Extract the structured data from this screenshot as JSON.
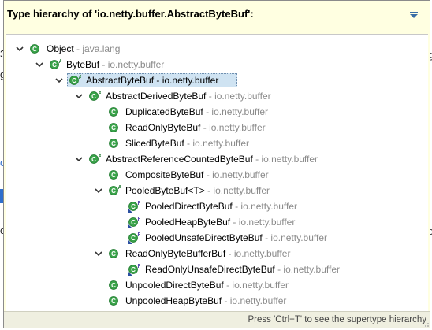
{
  "popup": {
    "title": "Type hierarchy of 'io.netty.buffer.AbstractByteBuf':",
    "footer_hint": "Press 'Ctrl+T' to see the supertype hierarchy"
  },
  "background_fragments": [
    "3",
    "g",
    "o",
    "c"
  ],
  "colors": {
    "popup_bg": "#ffffe1",
    "selection": "#cfe3f2",
    "class_icon": "#3aa34a",
    "abstract_marker": "#2a7d3a",
    "final_marker": "#5a4ab0",
    "package_text": "#8a8a8a"
  },
  "tree": [
    {
      "name": "Object",
      "package": "java.lang",
      "depth": 0,
      "expanded": true,
      "modifier": "",
      "abstract": false
    },
    {
      "name": "ByteBuf",
      "package": "io.netty.buffer",
      "depth": 1,
      "expanded": true,
      "modifier": "A",
      "abstract": true
    },
    {
      "name": "AbstractByteBuf",
      "package": "io.netty.buffer",
      "depth": 2,
      "expanded": true,
      "modifier": "A",
      "abstract": true,
      "selected": true
    },
    {
      "name": "AbstractDerivedByteBuf",
      "package": "io.netty.buffer",
      "depth": 3,
      "expanded": true,
      "modifier": "A",
      "abstract": true
    },
    {
      "name": "DuplicatedByteBuf",
      "package": "io.netty.buffer",
      "depth": 4,
      "expanded": null,
      "modifier": "",
      "abstract": false
    },
    {
      "name": "ReadOnlyByteBuf",
      "package": "io.netty.buffer",
      "depth": 4,
      "expanded": null,
      "modifier": "",
      "abstract": false
    },
    {
      "name": "SlicedByteBuf",
      "package": "io.netty.buffer",
      "depth": 4,
      "expanded": null,
      "modifier": "",
      "abstract": false
    },
    {
      "name": "AbstractReferenceCountedByteBuf",
      "package": "io.netty.buffer",
      "depth": 3,
      "expanded": true,
      "modifier": "A",
      "abstract": true
    },
    {
      "name": "CompositeByteBuf",
      "package": "io.netty.buffer",
      "depth": 4,
      "expanded": null,
      "modifier": "",
      "abstract": false
    },
    {
      "name": "PooledByteBuf<T>",
      "package": "io.netty.buffer",
      "depth": 4,
      "expanded": true,
      "modifier": "A",
      "abstract": true
    },
    {
      "name": "PooledDirectByteBuf",
      "package": "io.netty.buffer",
      "depth": 5,
      "expanded": null,
      "modifier": "F",
      "abstract": false,
      "final": true
    },
    {
      "name": "PooledHeapByteBuf",
      "package": "io.netty.buffer",
      "depth": 5,
      "expanded": null,
      "modifier": "F",
      "abstract": false,
      "final": true
    },
    {
      "name": "PooledUnsafeDirectByteBuf",
      "package": "io.netty.buffer",
      "depth": 5,
      "expanded": null,
      "modifier": "F",
      "abstract": false,
      "final": true
    },
    {
      "name": "ReadOnlyByteBufferBuf",
      "package": "io.netty.buffer",
      "depth": 4,
      "expanded": true,
      "modifier": "",
      "abstract": false
    },
    {
      "name": "ReadOnlyUnsafeDirectByteBuf",
      "package": "io.netty.buffer",
      "depth": 5,
      "expanded": null,
      "modifier": "F",
      "abstract": false,
      "final": true
    },
    {
      "name": "UnpooledDirectByteBuf",
      "package": "io.netty.buffer",
      "depth": 4,
      "expanded": null,
      "modifier": "",
      "abstract": false
    },
    {
      "name": "UnpooledHeapByteBuf",
      "package": "io.netty.buffer",
      "depth": 4,
      "expanded": null,
      "modifier": "",
      "abstract": false
    }
  ]
}
